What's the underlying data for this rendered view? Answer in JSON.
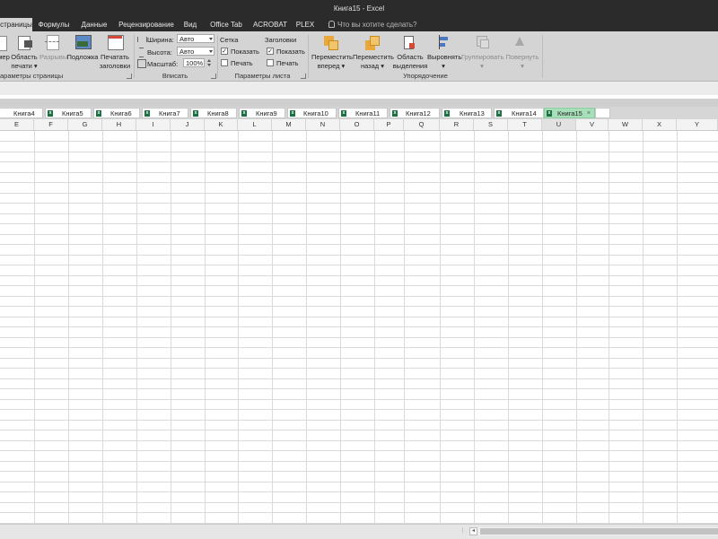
{
  "window": {
    "title": "Книга15 - Excel"
  },
  "ribbon_tabs": [
    {
      "label": "страницы",
      "active": true
    },
    {
      "label": "Формулы"
    },
    {
      "label": "Данные"
    },
    {
      "label": "Рецензирование"
    },
    {
      "label": "Вид"
    },
    {
      "label": "Office Tab"
    },
    {
      "label": "ACROBAT"
    },
    {
      "label": "PLEX"
    }
  ],
  "tell_me": {
    "placeholder": "Что вы хотите сделать?",
    "icon": "lightbulb-icon"
  },
  "ribbon": {
    "page_setup": {
      "buttons": [
        {
          "line1": "мер",
          "line2": ""
        },
        {
          "line1": "Область",
          "line2": "печати ▾"
        },
        {
          "line1": "Разрывы",
          "line2": ""
        },
        {
          "line1": "Подложка",
          "line2": ""
        },
        {
          "line1": "Печатать",
          "line2": "заголовки"
        }
      ],
      "label": "араметры страницы"
    },
    "fit": {
      "width_label": "Ширина:",
      "width_value": "Авто",
      "height_label": "Высота:",
      "height_value": "Авто",
      "scale_label": "Масштаб:",
      "scale_value": "100%",
      "label": "Вписать"
    },
    "sheet_options": {
      "gridlines_title": "Сетка",
      "headings_title": "Заголовки",
      "show_label": "Показать",
      "print_label": "Печать",
      "gridlines_show_checked": true,
      "gridlines_print_checked": false,
      "headings_show_checked": true,
      "headings_print_checked": false,
      "label": "Параметры листа"
    },
    "arrange": {
      "buttons": [
        {
          "line1": "Переместить",
          "line2": "вперед ▾",
          "disabled": false
        },
        {
          "line1": "Переместить",
          "line2": "назад ▾",
          "disabled": false
        },
        {
          "line1": "Область",
          "line2": "выделения",
          "disabled": false
        },
        {
          "line1": "Выровнять",
          "line2": "▾",
          "disabled": false
        },
        {
          "line1": "Группировать",
          "line2": "▾",
          "disabled": true
        },
        {
          "line1": "Повернуть",
          "line2": "▾",
          "disabled": true
        }
      ],
      "label": "Упорядочение"
    }
  },
  "workbook_tabs": [
    {
      "label": "Книга4"
    },
    {
      "label": "Книга5"
    },
    {
      "label": "Книга6"
    },
    {
      "label": "Книга7"
    },
    {
      "label": "Книга8"
    },
    {
      "label": "Книга9"
    },
    {
      "label": "Книга10"
    },
    {
      "label": "Книга11"
    },
    {
      "label": "Книга12"
    },
    {
      "label": "Книга13"
    },
    {
      "label": "Книга14"
    },
    {
      "label": "Книга15",
      "active": true,
      "close": "×"
    }
  ],
  "columns": [
    "E",
    "F",
    "G",
    "H",
    "I",
    "J",
    "K",
    "L",
    "M",
    "N",
    "O",
    "P",
    "Q",
    "R",
    "S",
    "T",
    "U",
    "V",
    "W",
    "X",
    "Y"
  ],
  "colors": {
    "titlebar": "#2b2b2b",
    "ribbon": "#d4d4d4",
    "active_tab": "#a7dfb9",
    "excel_green": "#1d7044"
  }
}
